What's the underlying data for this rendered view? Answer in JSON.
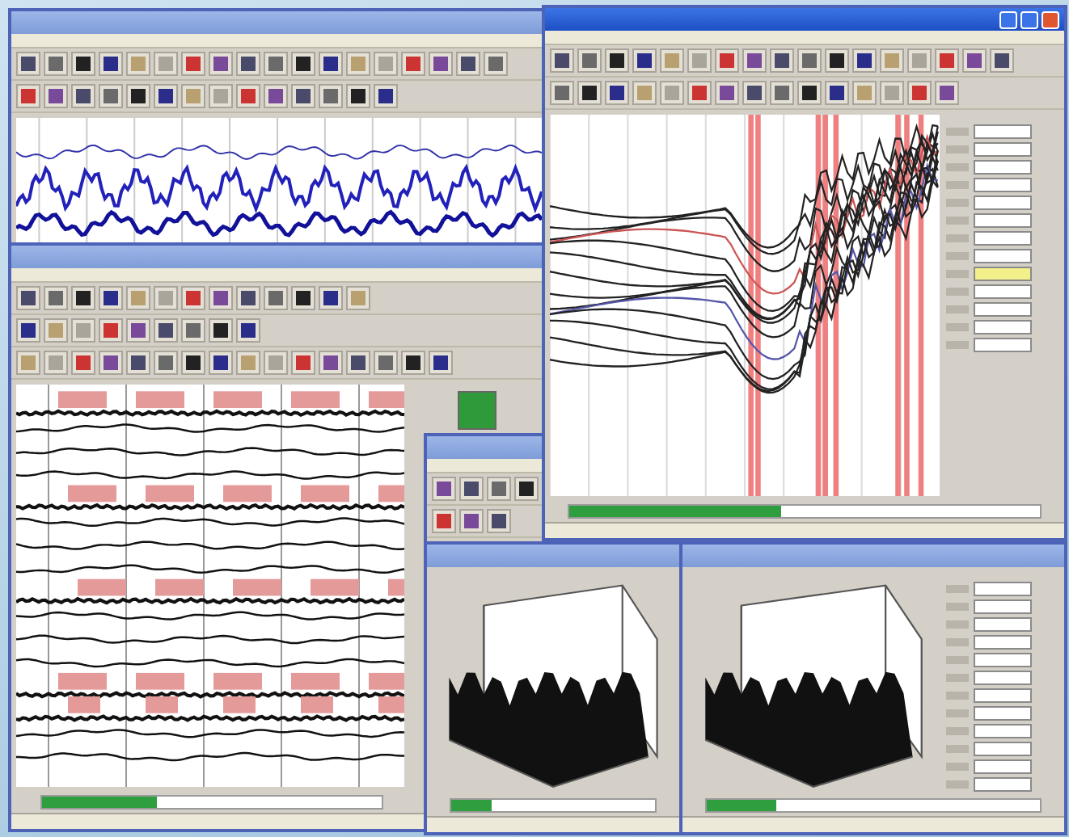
{
  "windows": [
    {
      "kind": "waveform",
      "active": false
    },
    {
      "kind": "multichannel",
      "active": false,
      "progress": {
        "level": 0.34
      }
    },
    {
      "kind": "small",
      "active": false
    },
    {
      "kind": "spectrum",
      "active": true,
      "progress": {
        "level": 0.45
      },
      "readings": [
        {
          "selected": false
        },
        {
          "selected": false
        },
        {
          "selected": false
        },
        {
          "selected": false
        },
        {
          "selected": false
        },
        {
          "selected": false
        },
        {
          "selected": false
        },
        {
          "selected": false
        },
        {
          "selected": true
        },
        {
          "selected": false
        },
        {
          "selected": false
        },
        {
          "selected": false
        },
        {
          "selected": false
        }
      ]
    },
    {
      "kind": "surface",
      "active": false,
      "progress": {
        "level": 0.2
      }
    },
    {
      "kind": "surface_table",
      "active": false,
      "progress": {
        "level": 0.21
      }
    }
  ]
}
